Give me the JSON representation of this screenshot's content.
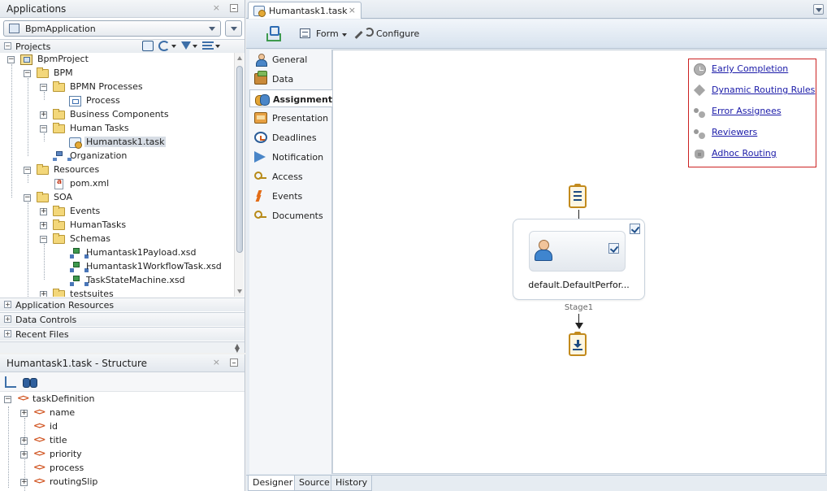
{
  "applications_panel": {
    "title": "Applications",
    "close_glyph": "×",
    "application": "BpmApplication",
    "projects_label": "Projects",
    "tree": [
      {
        "label": "BpmProject"
      },
      {
        "label": "BPM"
      },
      {
        "label": "BPMN Processes"
      },
      {
        "label": "Process"
      },
      {
        "label": "Business Components"
      },
      {
        "label": "Human Tasks"
      },
      {
        "label": "Humantask1.task"
      },
      {
        "label": "Organization"
      },
      {
        "label": "Resources"
      },
      {
        "label": "pom.xml"
      },
      {
        "label": "SOA"
      },
      {
        "label": "Events"
      },
      {
        "label": "HumanTasks"
      },
      {
        "label": "Schemas"
      },
      {
        "label": "Humantask1Payload.xsd"
      },
      {
        "label": "Humantask1WorkflowTask.xsd"
      },
      {
        "label": "TaskStateMachine.xsd"
      },
      {
        "label": "testsuites"
      }
    ],
    "sections": [
      "Application Resources",
      "Data Controls",
      "Recent Files"
    ]
  },
  "structure_panel": {
    "title": "Humantask1.task - Structure",
    "close_glyph": "×",
    "tree": [
      {
        "label": "taskDefinition"
      },
      {
        "label": "name"
      },
      {
        "label": "id"
      },
      {
        "label": "title"
      },
      {
        "label": "priority"
      },
      {
        "label": "process"
      },
      {
        "label": "routingSlip"
      }
    ]
  },
  "editor": {
    "tab_label": "Humantask1.task",
    "close_glyph": "×",
    "toolbar": {
      "form_label": "Form",
      "configure_label": "Configure"
    },
    "nav": [
      {
        "label": "General",
        "icon": "general-icon"
      },
      {
        "label": "Data",
        "icon": "data-icon"
      },
      {
        "label": "Assignment",
        "icon": "assignment-icon",
        "active": true
      },
      {
        "label": "Presentation",
        "icon": "presentation-icon"
      },
      {
        "label": "Deadlines",
        "icon": "deadlines-icon"
      },
      {
        "label": "Notification",
        "icon": "notification-icon"
      },
      {
        "label": "Access",
        "icon": "access-icon"
      },
      {
        "label": "Events",
        "icon": "events-icon"
      },
      {
        "label": "Documents",
        "icon": "documents-icon"
      }
    ],
    "routing_links": [
      {
        "label": "Early Completion",
        "icon": "clock-icon"
      },
      {
        "label": "Dynamic Routing Rules",
        "icon": "diamond-icon"
      },
      {
        "label": "Error Assignees",
        "icon": "people-icon"
      },
      {
        "label": "Reviewers",
        "icon": "people-icon"
      },
      {
        "label": "Adhoc Routing",
        "icon": "group-icon"
      }
    ],
    "routing_border_color": "#cc2222",
    "participant_label": "default.DefaultPerfor...",
    "stage_label": "Stage1",
    "bottom_tabs": [
      "Designer",
      "Source",
      "History"
    ]
  }
}
